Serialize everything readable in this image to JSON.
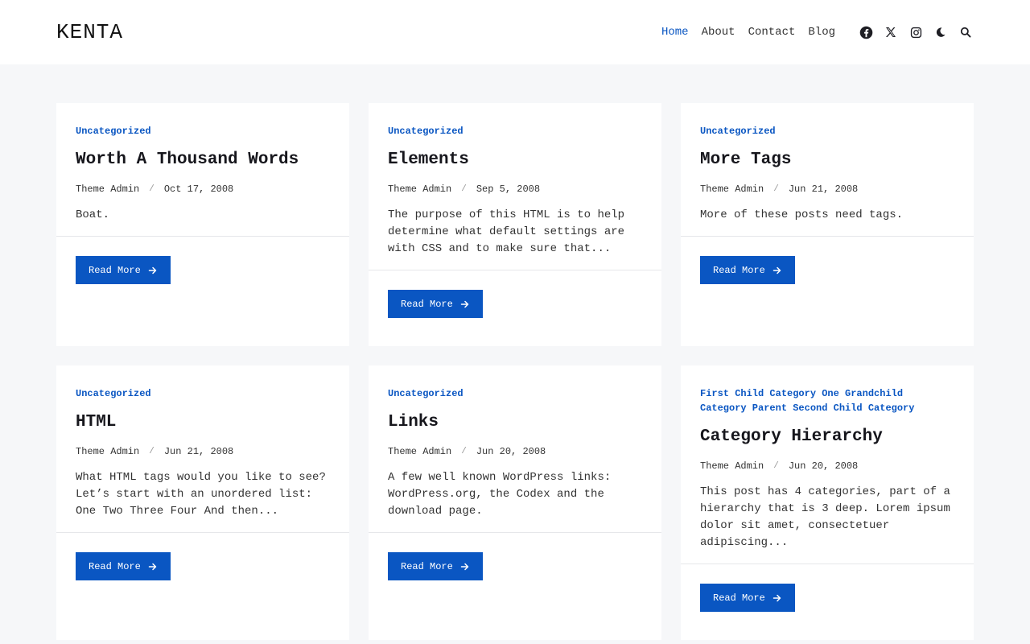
{
  "site": {
    "logo": "KENTA"
  },
  "nav": {
    "items": [
      "Home",
      "About",
      "Contact",
      "Blog"
    ],
    "active": "Home"
  },
  "icons": [
    "facebook-icon",
    "x-twitter-icon",
    "instagram-icon",
    "moon-icon",
    "search-icon"
  ],
  "colors": {
    "accent": "#0a56c2",
    "background": "#f6f7f9",
    "card": "#ffffff"
  },
  "posts": [
    {
      "category": "Uncategorized",
      "title": "Worth A Thousand Words",
      "author": "Theme Admin",
      "date": "Oct 17, 2008",
      "excerpt": "Boat.",
      "button": "Read More"
    },
    {
      "category": "Uncategorized",
      "title": "Elements",
      "author": "Theme Admin",
      "date": "Sep 5, 2008",
      "excerpt": "The purpose of this HTML is to help determine what default settings are with CSS and to make sure that...",
      "button": "Read More"
    },
    {
      "category": "Uncategorized",
      "title": "More Tags",
      "author": "Theme Admin",
      "date": "Jun 21, 2008",
      "excerpt": "More of these posts need tags.",
      "button": "Read More"
    },
    {
      "category": "Uncategorized",
      "title": "HTML",
      "author": "Theme Admin",
      "date": "Jun 21, 2008",
      "excerpt": "What HTML tags would you like to see? Let’s start with an unordered list: One Two Three Four And then...",
      "button": "Read More"
    },
    {
      "category": "Uncategorized",
      "title": "Links",
      "author": "Theme Admin",
      "date": "Jun 20, 2008",
      "excerpt": "A few well known WordPress links: WordPress.org, the Codex and the download page.",
      "button": "Read More"
    },
    {
      "category": "First Child Category One Grandchild Category Parent Second Child Category",
      "title": "Category Hierarchy",
      "author": "Theme Admin",
      "date": "Jun 20, 2008",
      "excerpt": "This post has 4 categories, part of a hierarchy that is 3 deep. Lorem ipsum dolor sit amet, consectetuer adipiscing...",
      "button": "Read More"
    }
  ]
}
